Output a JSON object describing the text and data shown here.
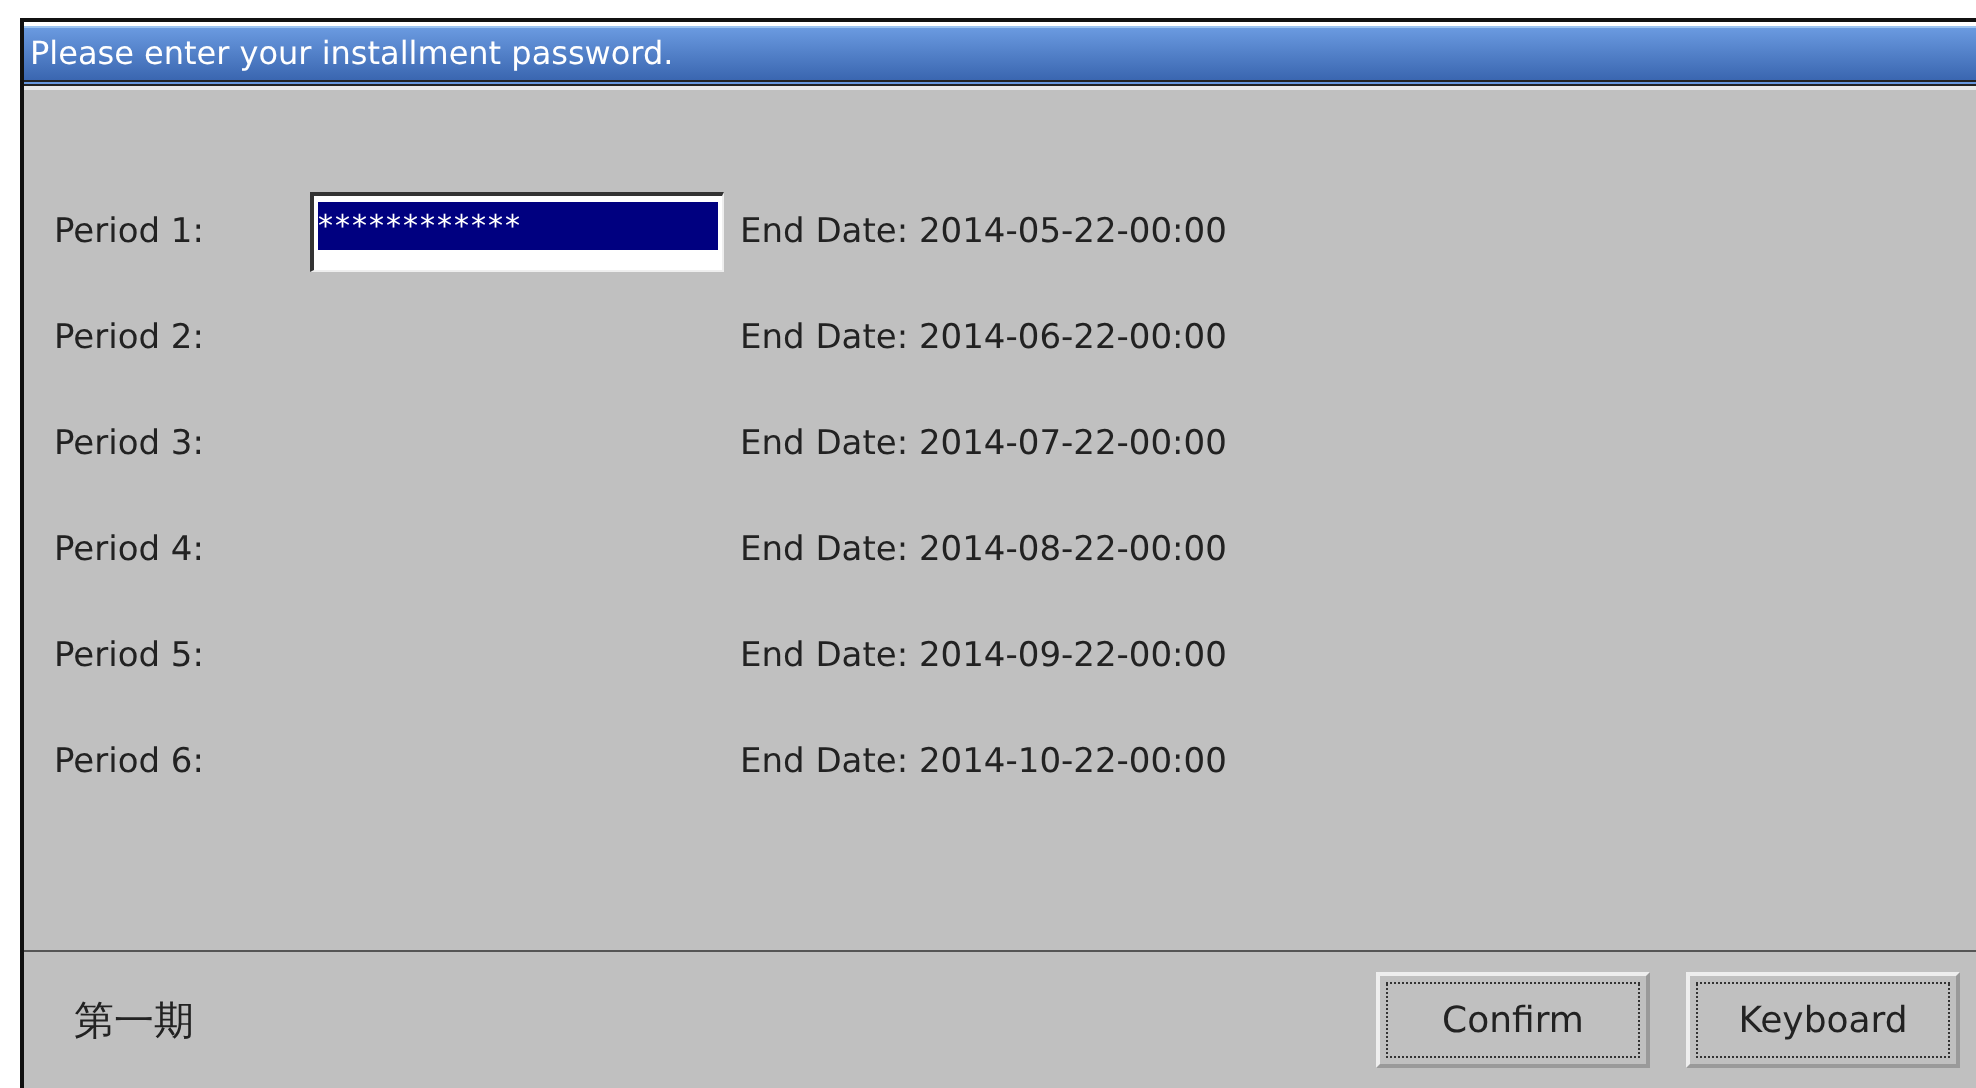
{
  "window": {
    "title": "Please enter your installment password."
  },
  "periods": [
    {
      "kind": "field",
      "label": "Period 1:",
      "field_value": "************",
      "field_focused": true,
      "end_date": "End Date: 2014-05-22-00:00"
    },
    {
      "kind": "plain",
      "label": "Period 2:",
      "end_date": "End Date: 2014-06-22-00:00"
    },
    {
      "kind": "plain",
      "label": "Period 3:",
      "end_date": "End Date: 2014-07-22-00:00"
    },
    {
      "kind": "plain",
      "label": "Period 4:",
      "end_date": "End Date: 2014-08-22-00:00"
    },
    {
      "kind": "plain",
      "label": "Period 5:",
      "end_date": "End Date: 2014-09-22-00:00"
    },
    {
      "kind": "plain",
      "label": "Period 6:",
      "end_date": "End Date: 2014-10-22-00:00"
    }
  ],
  "status_text": "第一期",
  "buttons": [
    "Confirm",
    "Keyboard"
  ]
}
